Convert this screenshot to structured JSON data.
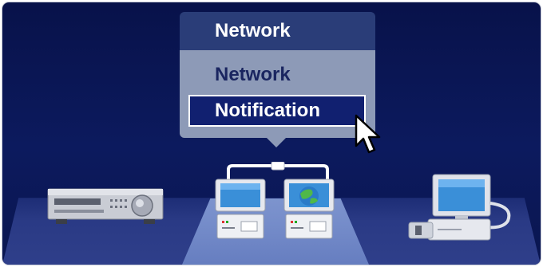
{
  "menu": {
    "title": "Network",
    "items": [
      {
        "label": "Network",
        "selected": false
      },
      {
        "label": "Notification",
        "selected": true
      }
    ],
    "selected_index": 1
  },
  "devices": [
    {
      "name": "receiver",
      "icon": "av-receiver-icon"
    },
    {
      "name": "network",
      "icon": "network-computers-icon"
    },
    {
      "name": "projector",
      "icon": "computer-projector-icon"
    }
  ],
  "colors": {
    "background": "#0c1a5e",
    "menu_title_bg": "#2a3d78",
    "menu_panel_bg": "#8d9ab7",
    "selection_bg": "#112070",
    "highlight_floor": "#7f97d4"
  }
}
